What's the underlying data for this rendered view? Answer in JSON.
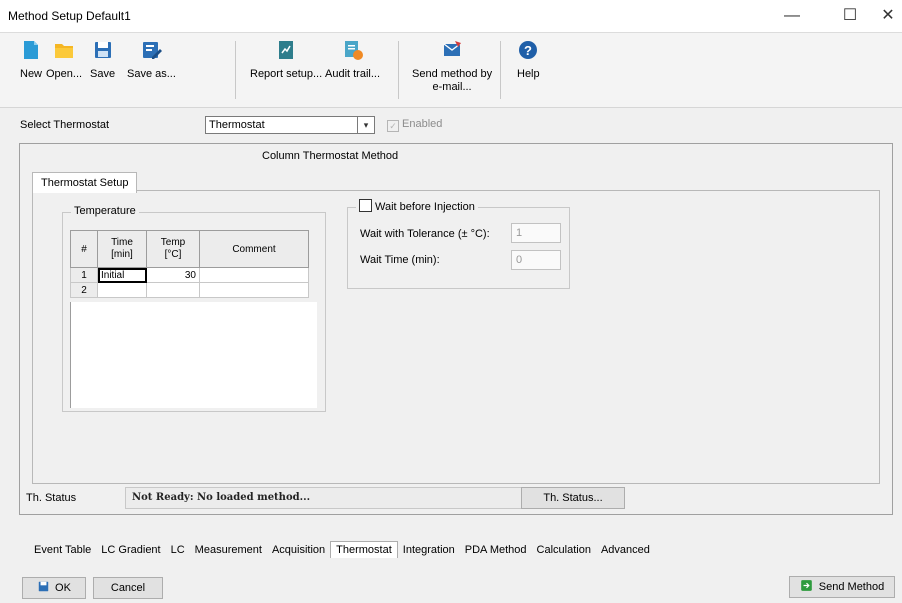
{
  "window": {
    "title": "Method Setup Default1",
    "minimize": "—",
    "maximize": "☐",
    "close": "✕"
  },
  "toolbar": {
    "new": "New",
    "open": "Open...",
    "save": "Save",
    "save_as": "Save as...",
    "report_setup": "Report setup...",
    "audit_trail": "Audit trail...",
    "send_method_line1": "Send method by",
    "send_method_line2": "e-mail...",
    "help": "Help"
  },
  "select_thermostat": {
    "label": "Select Thermostat",
    "value": "Thermostat",
    "enabled_label": "Enabled"
  },
  "panel": {
    "title": "Column Thermostat Method",
    "tab": "Thermostat Setup"
  },
  "temperature": {
    "group_label": "Temperature",
    "columns": {
      "num": "#",
      "time": "Time\n[min]",
      "temp": "Temp\n[°C]",
      "comment": "Comment"
    },
    "rows": [
      {
        "num": "1",
        "time": "Initial",
        "temp": "30",
        "comment": ""
      },
      {
        "num": "2",
        "time": "",
        "temp": "",
        "comment": ""
      }
    ]
  },
  "wait": {
    "checkbox_label": "Wait before Injection",
    "tolerance_label": "Wait with Tolerance (± °C):",
    "tolerance_value": "1",
    "time_label": "Wait Time (min):",
    "time_value": "0"
  },
  "status": {
    "label": "Th. Status",
    "text": "Not Ready: No loaded method...",
    "button": "Th. Status..."
  },
  "tabs": [
    "Event Table",
    "LC Gradient",
    "LC",
    "Measurement",
    "Acquisition",
    "Thermostat",
    "Integration",
    "PDA Method",
    "Calculation",
    "Advanced"
  ],
  "active_tab": "Thermostat",
  "bottom": {
    "ok": "OK",
    "cancel": "Cancel",
    "send_method": "Send Method"
  }
}
